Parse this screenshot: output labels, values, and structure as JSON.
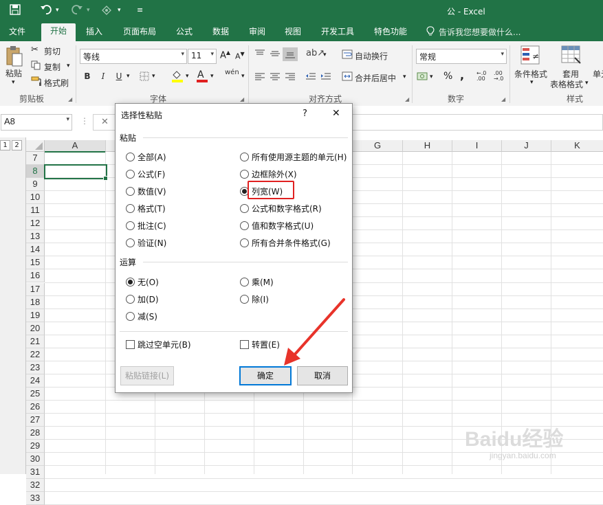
{
  "window": {
    "title": "公 - Excel"
  },
  "tabs": [
    "文件",
    "开始",
    "插入",
    "页面布局",
    "公式",
    "数据",
    "审阅",
    "视图",
    "开发工具",
    "特色功能"
  ],
  "tell_me": "告诉我您想要做什么...",
  "ribbon": {
    "paste": "粘贴",
    "cut": "剪切",
    "copy": "复制",
    "format_painter": "格式刷",
    "clipboard_group": "剪贴板",
    "font_name": "等线",
    "font_size": "11",
    "font_group": "字体",
    "wrap_text": "自动换行",
    "merge_center": "合并后居中",
    "align_group": "对齐方式",
    "number_format": "常规",
    "number_group": "数字",
    "cond_format": "条件格式",
    "table_format_1": "套用",
    "table_format_2": "表格格式",
    "cell_styles": "单元",
    "styles_group": "样式",
    "bold": "B",
    "italic": "I",
    "underline": "U",
    "phonetic": "wén",
    "font_color_label": "A",
    "percent": "%",
    "comma": ","
  },
  "formula_bar": {
    "name_box": "A8",
    "cancel_symbol": "✕"
  },
  "grid": {
    "outline_levels": [
      "1",
      "2"
    ],
    "columns": [
      "A",
      "G",
      "H",
      "I",
      "J",
      "K"
    ],
    "rows": [
      "7",
      "8",
      "9",
      "10",
      "11",
      "12",
      "13",
      "14",
      "15",
      "16",
      "17",
      "18",
      "19",
      "20",
      "21",
      "22",
      "23",
      "24",
      "25",
      "26",
      "27",
      "28",
      "29",
      "30",
      "31",
      "32",
      "33"
    ]
  },
  "dialog": {
    "title": "选择性粘贴",
    "help": "?",
    "close": "✕",
    "paste_section": "粘贴",
    "paste_left": [
      "全部(A)",
      "公式(F)",
      "数值(V)",
      "格式(T)",
      "批注(C)",
      "验证(N)"
    ],
    "paste_right": [
      "所有使用源主题的单元(H)",
      "边框除外(X)",
      "列宽(W)",
      "公式和数字格式(R)",
      "值和数字格式(U)",
      "所有合并条件格式(G)"
    ],
    "selected_paste": "列宽(W)",
    "operation_section": "运算",
    "op_left": [
      "无(O)",
      "加(D)",
      "减(S)"
    ],
    "op_right": [
      "乘(M)",
      "除(I)"
    ],
    "selected_operation": "无(O)",
    "skip_blanks": "跳过空单元(B)",
    "transpose": "转置(E)",
    "paste_link": "粘贴链接(L)",
    "ok": "确定",
    "cancel": "取消"
  },
  "watermark": {
    "logo": "Baidu经验",
    "url": "jingyan.baidu.com"
  },
  "colors": {
    "excel_green": "#217346",
    "highlight_red": "#e02020",
    "arrow_red": "#e8332a"
  }
}
